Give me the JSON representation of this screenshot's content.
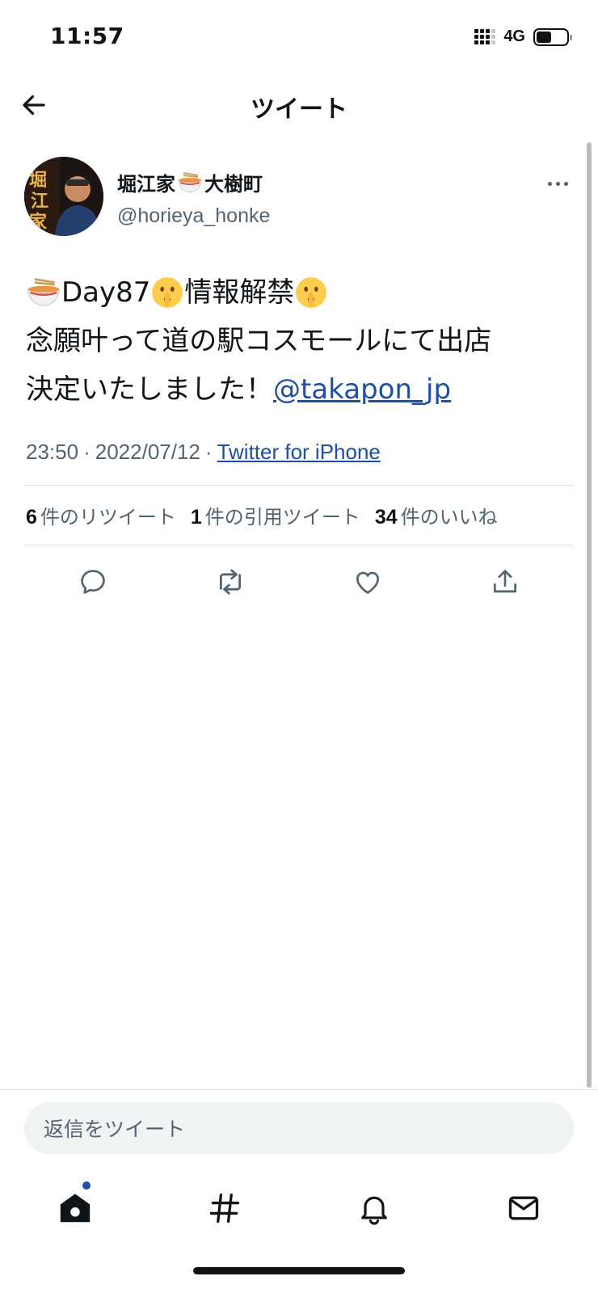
{
  "status_bar": {
    "time": "11:57",
    "network": "4G"
  },
  "nav": {
    "title": "ツイート"
  },
  "tweet": {
    "author_name_part1": "堀江家",
    "author_name_part2": "大樹町",
    "handle": "@horieya_honke",
    "avatar_text": "堀江家",
    "text_line1_a": "Day87",
    "text_line1_b": "情報解禁",
    "text_line2": "念願叶って道の駅コスモールにて出店",
    "text_line3": "決定いたしました！",
    "mention": "@takapon_jp",
    "time": "23:50",
    "date": "2022/07/12",
    "separator": "·",
    "source": "Twitter for iPhone"
  },
  "stats": {
    "retweets_count": "6",
    "retweets_label": "件のリツイート",
    "quotes_count": "1",
    "quotes_label": "件の引用ツイート",
    "likes_count": "34",
    "likes_label": "件のいいね"
  },
  "reply": {
    "placeholder": "返信をツイート"
  },
  "icons": {
    "back": "arrow-left-icon",
    "more": "more-horizontal-icon",
    "reply": "comment-icon",
    "retweet": "retweet-icon",
    "like": "heart-icon",
    "share": "share-icon",
    "home": "home-icon",
    "explore": "hashtag-icon",
    "notifications": "bell-icon",
    "messages": "mail-icon"
  },
  "colors": {
    "link": "#1d4ea8",
    "secondary_text": "#536471",
    "home_badge": "#1d4ea8"
  }
}
